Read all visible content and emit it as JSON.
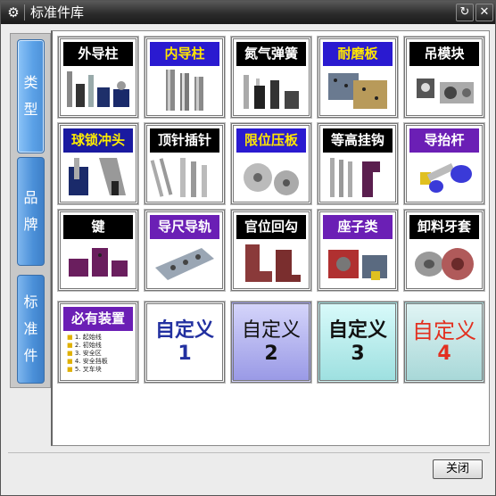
{
  "window": {
    "title": "标准件库"
  },
  "titlebar": {
    "gear_icon": "⚙",
    "refresh_icon": "↻",
    "close_icon": "✕"
  },
  "tabs": [
    {
      "label": "类型",
      "active": true
    },
    {
      "label": "品牌",
      "active": false
    },
    {
      "label": "标准件",
      "active": false
    }
  ],
  "tiles": [
    {
      "label": "外导柱",
      "style": "black",
      "icon": "guide-post-icon"
    },
    {
      "label": "内导柱",
      "style": "blue",
      "icon": "inner-guide-post-icon"
    },
    {
      "label": "氮气弹簧",
      "style": "black",
      "icon": "gas-spring-icon"
    },
    {
      "label": "耐磨板",
      "style": "blue",
      "icon": "wear-plate-icon"
    },
    {
      "label": "吊模块",
      "style": "black",
      "icon": "lifting-block-icon"
    },
    {
      "label": "球锁冲头",
      "style": "navy",
      "icon": "ball-lock-punch-icon"
    },
    {
      "label": "顶针插针",
      "style": "black",
      "icon": "ejector-pin-icon"
    },
    {
      "label": "限位压板",
      "style": "blue",
      "icon": "stop-plate-icon"
    },
    {
      "label": "等高挂钩",
      "style": "black",
      "icon": "hook-icon"
    },
    {
      "label": "导抬杆",
      "style": "purple",
      "icon": "lifter-bar-icon"
    },
    {
      "label": "键",
      "style": "black",
      "icon": "key-icon"
    },
    {
      "label": "导尺导轨",
      "style": "purple",
      "icon": "guide-rail-icon"
    },
    {
      "label": "官位回勾",
      "style": "black",
      "icon": "return-hook-icon"
    },
    {
      "label": "座子类",
      "style": "purple",
      "icon": "seat-block-icon"
    },
    {
      "label": "卸料牙套",
      "style": "black",
      "icon": "stripper-sleeve-icon"
    },
    {
      "label": "必有装置",
      "style": "purple",
      "icon": "required-device-list-icon",
      "list": [
        "1. 起始线",
        "2. 初始线",
        "3. 安全区",
        "4. 安全挡板",
        "5. 叉车块"
      ]
    }
  ],
  "custom_tiles": [
    {
      "line1": "自定义",
      "line2": "1",
      "color": "#2230a0",
      "bg": "#ffffff"
    },
    {
      "line1": "自定义",
      "line2": "2",
      "color": "#111111",
      "bg": "#b4b4f0"
    },
    {
      "line1": "自定义",
      "line2": "3",
      "color": "#111111",
      "bg": "#bff0f0"
    },
    {
      "line1": "自定义",
      "line2": "4",
      "color": "#e23020",
      "bg": "#c4eaea"
    }
  ],
  "footer": {
    "close_label": "关闭"
  }
}
